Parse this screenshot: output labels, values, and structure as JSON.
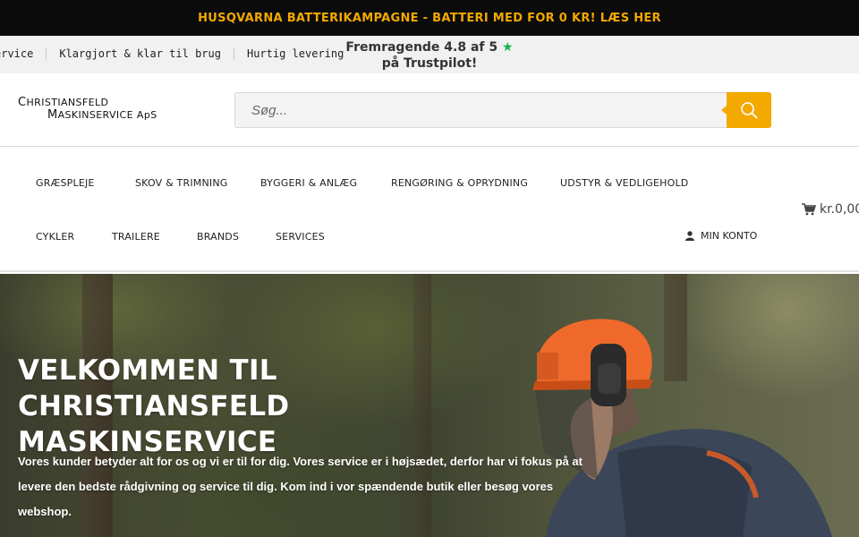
{
  "top_banner": {
    "text": "HUSQVARNA BATTERIKAMPAGNE - BATTERI MED FOR 0 KR! LÆS HER"
  },
  "info_bar": {
    "usps": [
      "ervice",
      "Klargjort & klar til brug",
      "Hurtig levering"
    ],
    "trust_line1": "Fremragende 4.8 af 5",
    "trust_star": "★",
    "trust_line2": "på Trustpilot!"
  },
  "header": {
    "logo_line1_cap": "C",
    "logo_line1_rest": "HRISTIANSFELD",
    "logo_line2_cap": "M",
    "logo_line2_rest": "ASKINSERVICE ApS",
    "search_placeholder": "Søg...",
    "search_icon": "search-icon"
  },
  "nav": {
    "row1": [
      "GRÆSPLEJE",
      "SKOV & TRIMNING",
      "BYGGERI & ANLÆG",
      "RENGØRING & OPRYDNING",
      "UDSTYR & VEDLIGEHOLD"
    ],
    "row2": [
      "CYKLER",
      "TRAILERE",
      "BRANDS",
      "SERVICES"
    ],
    "cart_amount": "kr.0,00",
    "cart_icon": "cart-icon",
    "account_label": "MIN KONTO",
    "account_icon": "user-icon"
  },
  "hero": {
    "title_line1": "VELKOMMEN TIL CHRISTIANSFELD",
    "title_line2": "MASKINSERVICE",
    "text_line1": "Vores kunder betyder alt for os og vi er til for dig. Vores service er i højsædet, derfor har vi fokus på at",
    "text_line2": "levere den bedste rådgivning og service til dig. Kom ind i vor spændende butik eller besøg vores",
    "text_line3": "webshop."
  },
  "colors": {
    "accent": "#f2a900",
    "top_bar_bg": "#0b0b0b",
    "trustpilot_green": "#19b34a"
  }
}
